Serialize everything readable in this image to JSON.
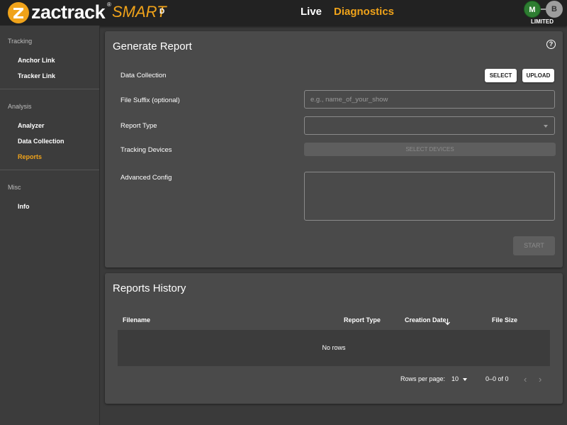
{
  "header": {
    "brand": "zactrack",
    "brand_mark": "®",
    "product": "SMART",
    "edition": "D",
    "nav": [
      {
        "label": "Live",
        "active": false
      },
      {
        "label": "Diagnostics",
        "active": true
      }
    ],
    "badges": [
      "M",
      "B"
    ],
    "license": "LIMITED",
    "accent": "#f0a31a"
  },
  "sidebar": {
    "sections": [
      {
        "title": "Tracking",
        "items": [
          "Anchor Link",
          "Tracker Link"
        ]
      },
      {
        "title": "Analysis",
        "items": [
          "Analyzer",
          "Data Collection",
          "Reports"
        ]
      },
      {
        "title": "Misc",
        "items": [
          "Info"
        ]
      }
    ],
    "active_item": "Reports"
  },
  "report": {
    "title": "Generate Report",
    "help_icon": "question-circle-icon",
    "fields": {
      "data_collection": "Data Collection",
      "file_suffix": "File Suffix (optional)",
      "report_type": "Report Type",
      "tracking_devices": "Tracking Devices",
      "advanced_config": "Advanced Config"
    },
    "select_label": "SELECT",
    "upload_label": "UPLOAD",
    "suffix_placeholder": "e.g., name_of_your_show",
    "suffix_value": "",
    "report_type_value": "",
    "advanced_value": "",
    "select_devices_label": "SELECT DEVICES",
    "start_label": "START"
  },
  "history": {
    "title": "Reports History",
    "columns": [
      "Filename",
      "Report Type",
      "Creation Date",
      "File Size"
    ],
    "sort_icon": "arrow-down-icon",
    "empty_text": "No rows",
    "rows_per_page_label": "Rows per page:",
    "rows_per_page": "10",
    "range": "0–0 of 0"
  }
}
